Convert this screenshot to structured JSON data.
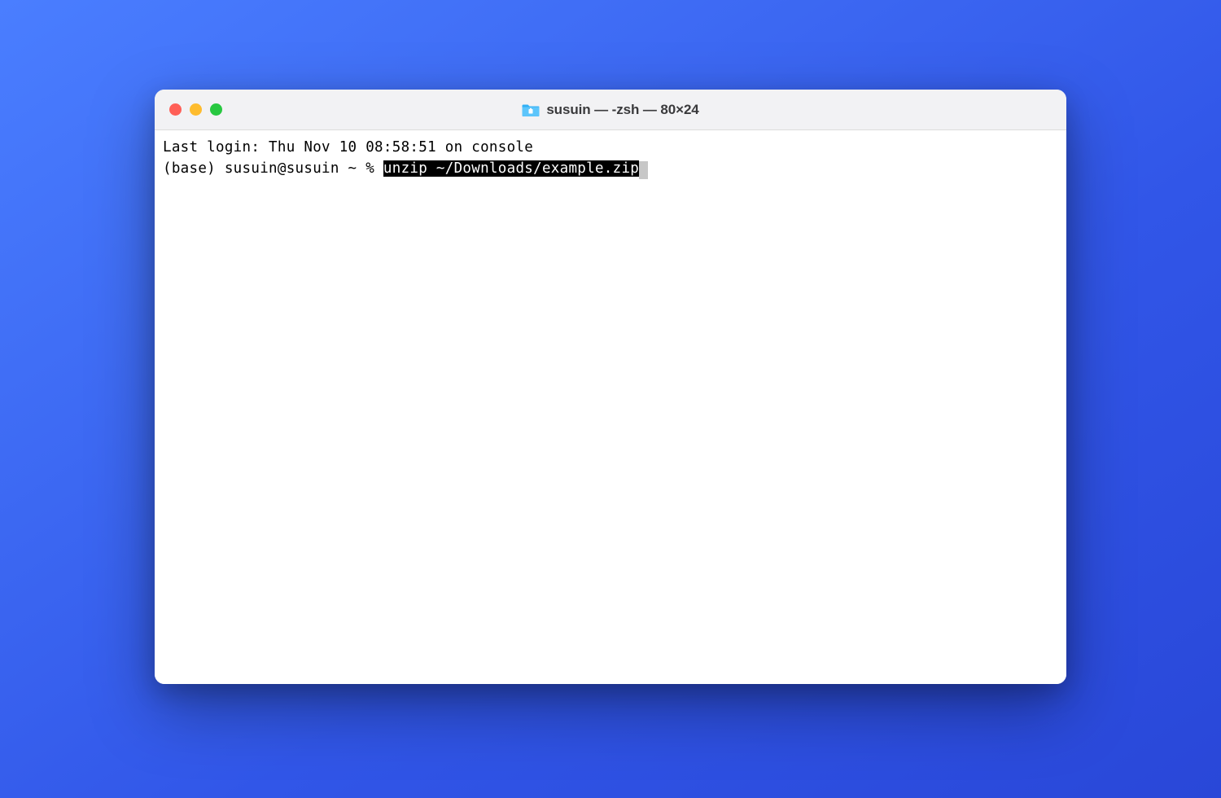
{
  "window": {
    "title": "susuin — -zsh — 80×24"
  },
  "terminal": {
    "last_login": "Last login: Thu Nov 10 08:58:51 on console",
    "prompt": "(base) susuin@susuin ~ % ",
    "command": "unzip ~/Downloads/example.zip"
  },
  "traffic_lights": {
    "close_color": "#ff5f57",
    "minimize_color": "#febc2e",
    "maximize_color": "#28c840"
  }
}
